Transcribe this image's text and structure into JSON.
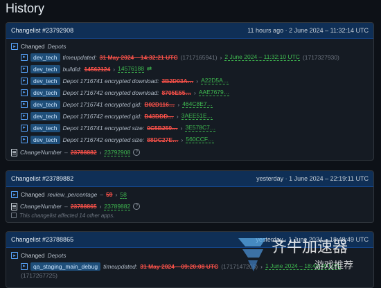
{
  "page_title": "History",
  "cards": [
    {
      "title": "Changelist #23792908",
      "time": "11 hours ago · 2 June 2024 – 11:32:14 UTC",
      "section_prefix": "Changed",
      "section_name": "Depots",
      "rows": [
        {
          "tag": "dev_tech",
          "label": "timeupdated:",
          "old": "31 May 2024 – 14:32:21 UTC",
          "old_extra": "(1717165941)",
          "new": "2 June 2024 – 11:32:10 UTC",
          "new_extra": "(1717327930)"
        },
        {
          "tag": "dev_tech",
          "label": "buildid:",
          "old": "14562124",
          "new": "14576188"
        },
        {
          "tag": "dev_tech",
          "label": "Depot 1716741 encrypted download:",
          "old": "3B2D03A…",
          "new": "A22D5A…"
        },
        {
          "tag": "dev_tech",
          "label": "Depot 1716742 encrypted download:",
          "old": "8705E55…",
          "new": "AAE7679…"
        },
        {
          "tag": "dev_tech",
          "label": "Depot 1716741 encrypted gid:",
          "old": "B02D116…",
          "new": "464C8E7…"
        },
        {
          "tag": "dev_tech",
          "label": "Depot 1716742 encrypted gid:",
          "old": "D43DDD…",
          "new": "3AEE51E…"
        },
        {
          "tag": "dev_tech",
          "label": "Depot 1716741 encrypted size:",
          "old": "0C5B259…",
          "new": "3E578C7…"
        },
        {
          "tag": "dev_tech",
          "label": "Depot 1716742 encrypted size:",
          "old": "88DC27E…",
          "new": "560CCF…"
        }
      ],
      "footer_label": "ChangeNumber",
      "footer_old": "23788882",
      "footer_new": "23792908"
    },
    {
      "title": "Changelist #23789882",
      "time": "yesterday · 1 June 2024 – 22:19:11 UTC",
      "changed_prefix": "Changed",
      "changed_key": "review_percentage",
      "changed_old": "59",
      "changed_new": "58",
      "footer_label": "ChangeNumber",
      "footer_old": "23788865",
      "footer_new": "23789882",
      "note": "This changelist affected 14 other apps."
    },
    {
      "title": "Changelist #23788865",
      "time": "yesterday · 1 June 2024 – 18:48:49 UTC",
      "section_prefix": "Changed",
      "section_name": "Depots",
      "row_tag": "qa_staging_main_debug",
      "row_label": "timeupdated:",
      "row_old": "31 May 2024 – 09:20:08 UTC",
      "row_old_extra": "(1717147208)",
      "row_new": "1 June 2024 – 18:48:45 UTC",
      "row_new_extra": "(1717267725)"
    }
  ],
  "watermark": {
    "text": "齐牛加速器",
    "sub": "游戏推荐"
  }
}
